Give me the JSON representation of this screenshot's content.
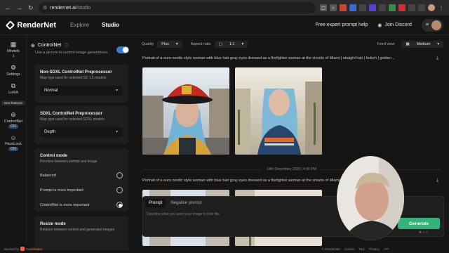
{
  "browser": {
    "host": "rendernet.ai",
    "path": "/studio"
  },
  "header": {
    "logo": "RenderNet",
    "nav": [
      "Explore",
      "Studio"
    ],
    "expert_help": "Free expert prompt help",
    "discord": "Join Discord"
  },
  "rail": {
    "models": {
      "label": "Models",
      "count": "1"
    },
    "settings": {
      "label": "Settings"
    },
    "lora": {
      "label": "LoRA"
    },
    "new_tag": "New features",
    "controlnet": {
      "label": "ControlNet",
      "status": "ON"
    },
    "facelock": {
      "label": "FaceLock",
      "status": "ON"
    }
  },
  "panel": {
    "title": "ControlNet",
    "subtitle": "Use a picture to control image generations",
    "toggle_on": true,
    "nonsdxl": {
      "title": "Non-SDXL ControlNet Preprocessor",
      "desc": "Map type used for selected SD 1.5 models",
      "value": "Normal"
    },
    "sdxl": {
      "title": "SDXL ControlNet Preprocessor",
      "desc": "Map type used for selected SDXL models",
      "value": "Depth"
    },
    "control_mode": {
      "title": "Control mode",
      "desc": "Prioritize between prompt and image",
      "options": [
        "Balanced",
        "Prompt is more important",
        "ControlNet is more important"
      ],
      "selected_index": 2
    },
    "resize_mode": {
      "title": "Resize mode",
      "desc": "Relation between control and generated images"
    }
  },
  "toolbar": {
    "quality_label": "Quality",
    "quality_value": "Plus",
    "aspect_label": "Aspect ratio",
    "aspect_value": "1:1",
    "feed_label": "Feed view",
    "feed_value": "Medium"
  },
  "feed": {
    "prompt_1": "Portrait of a euro nordic style woman with blue hair gray eyes dressed as a firefighter woman at the streets of Miami | straight hair | bokeh | golden...",
    "date": "14th December, 2023 | 4:35 PM",
    "prompt_2": "Portrait of a euro nordic style woman with blue hair gray eyes dressed as a firefighter woman at the streets of Miami | straight hair | bokeh | golden..."
  },
  "prompt_box": {
    "tabs": [
      "Prompt",
      "Negative prompt"
    ],
    "placeholder": "Describe what you want your image to look like",
    "generate": "Generate",
    "hint": "⌘ + ⏎"
  },
  "footer": {
    "backed_by": "Backed by",
    "backer": "Combinator",
    "copyright": "© RenderNet",
    "links": [
      "Credits",
      "T&C",
      "Privacy",
      "API"
    ]
  }
}
